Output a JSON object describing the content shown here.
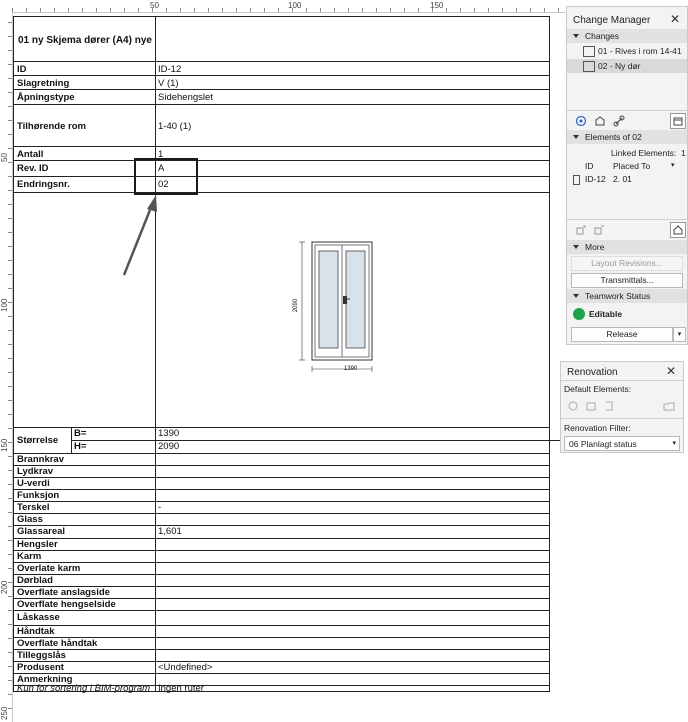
{
  "ruler": {
    "top_labels": [
      "50",
      "100",
      "150"
    ],
    "left_labels": [
      "50",
      "100",
      "150",
      "200",
      "250"
    ]
  },
  "schedule": {
    "title": "01 ny Skjema dører (A4) nye",
    "rows_top": [
      {
        "label": "ID",
        "value": "ID-12"
      },
      {
        "label": "Slagretning",
        "value": "V (1)"
      },
      {
        "label": "Åpningstype",
        "value": "Sidehengslet"
      },
      {
        "label": "Tilhørende rom",
        "value": "1-40 (1)"
      },
      {
        "label": "Antall",
        "value": "1"
      },
      {
        "label": "Rev. ID",
        "value": "A"
      },
      {
        "label": "Endringsnr.",
        "value": "02"
      }
    ],
    "size": {
      "label": "Størrelse",
      "b_label": "B=",
      "b_value": "1390",
      "h_label": "H=",
      "h_value": "2090"
    },
    "drawing": {
      "dim_height": "2090",
      "dim_width": "1390"
    },
    "rows_bottom": [
      {
        "label": "Brannkrav",
        "value": ""
      },
      {
        "label": "Lydkrav",
        "value": ""
      },
      {
        "label": "U-verdi",
        "value": ""
      },
      {
        "label": "Funksjon",
        "value": ""
      },
      {
        "label": "Terskel",
        "value": "-"
      },
      {
        "label": "Glass",
        "value": ""
      },
      {
        "label": "Glassareal",
        "value": "1,601"
      },
      {
        "label": "Hengsler",
        "value": ""
      },
      {
        "label": "Karm",
        "value": ""
      },
      {
        "label": "Overlate karm",
        "value": ""
      },
      {
        "label": "Dørblad",
        "value": ""
      },
      {
        "label": "Overflate anslagside",
        "value": ""
      },
      {
        "label": "Overflate hengselside",
        "value": ""
      },
      {
        "label": "Låskasse",
        "value": ""
      },
      {
        "label": "Håndtak",
        "value": ""
      },
      {
        "label": "Overflate håndtak",
        "value": ""
      },
      {
        "label": "Tilleggslås",
        "value": ""
      },
      {
        "label": "Produsent",
        "value": "<Undefined>"
      },
      {
        "label": "Anmerkning",
        "value": ""
      },
      {
        "label": "Kun for sortering i BIM-program",
        "value": "Ingen ruter"
      }
    ]
  },
  "change_manager": {
    "title": "Change Manager",
    "close": "✕",
    "changes_header": "Changes",
    "changes": [
      "01 - Rives i rom 14-41",
      "02 - Ny dør"
    ],
    "elements_header": "Elements of 02",
    "linked_label": "Linked Elements:",
    "linked_count": "1",
    "col_id": "ID",
    "col_placed": "Placed To",
    "element_id": "ID-12",
    "element_placed": "2. 01",
    "more_header": "More",
    "layout_revisions": "Layout Revisions...",
    "transmittals": "Transmittals...",
    "teamwork_header": "Teamwork Status",
    "status": "Editable",
    "release": "Release"
  },
  "renovation": {
    "title": "Renovation",
    "close": "✕",
    "default_elements": "Default Elements:",
    "filter_label": "Renovation Filter:",
    "filter_value": "06 Planlagt status"
  },
  "colors": {
    "accent_green": "#1fa34a",
    "panel_bg": "#f3f3f3",
    "section_bg": "#e1e1e1"
  }
}
